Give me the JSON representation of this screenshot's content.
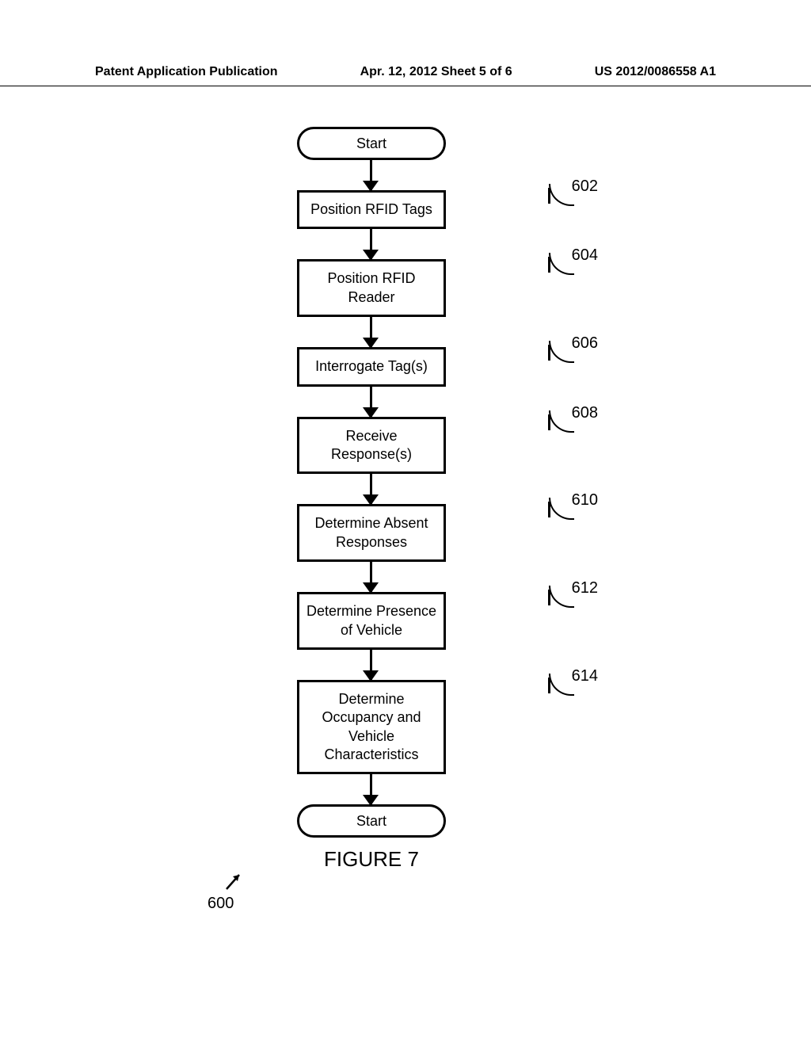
{
  "header": {
    "left": "Patent Application Publication",
    "center": "Apr. 12, 2012  Sheet 5 of 6",
    "right": "US 2012/0086558 A1"
  },
  "flowchart": {
    "start": "Start",
    "steps": [
      {
        "label": "Position RFID Tags",
        "ref": "602"
      },
      {
        "label": "Position RFID\nReader",
        "ref": "604"
      },
      {
        "label": "Interrogate Tag(s)",
        "ref": "606"
      },
      {
        "label": "Receive\nResponse(s)",
        "ref": "608"
      },
      {
        "label": "Determine Absent\nResponses",
        "ref": "610"
      },
      {
        "label": "Determine Presence\nof Vehicle",
        "ref": "612"
      },
      {
        "label": "Determine\nOccupancy and\nVehicle\nCharacteristics",
        "ref": "614"
      }
    ],
    "end": "Start",
    "figure_label": "FIGURE 7",
    "ref_600": "600"
  }
}
